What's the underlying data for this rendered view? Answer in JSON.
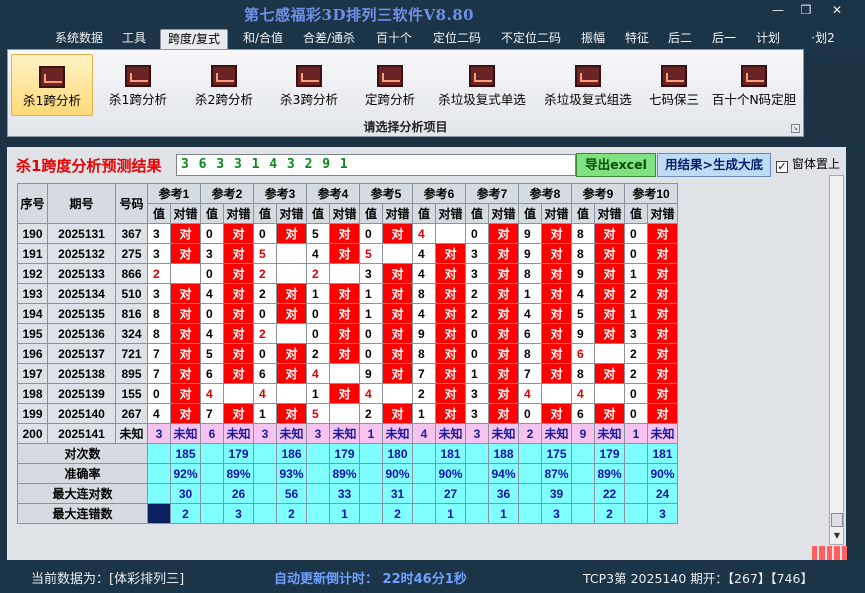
{
  "window": {
    "title": "第七感福彩3D排列三软件V8.80",
    "minimize_icon": "minimize-icon",
    "restore_icon": "restore-icon",
    "close_icon": "close-icon"
  },
  "menu": [
    {
      "label": "系统数据",
      "active": false
    },
    {
      "label": "工具",
      "active": false
    },
    {
      "label": "跨度/复式",
      "active": true
    },
    {
      "label": "和/合值",
      "active": false
    },
    {
      "label": "合差/通杀",
      "active": false
    },
    {
      "label": "百十个",
      "active": false
    },
    {
      "label": "定位二码",
      "active": false
    },
    {
      "label": "不定位二码",
      "active": false
    },
    {
      "label": "振幅",
      "active": false
    },
    {
      "label": "特征",
      "active": false
    },
    {
      "label": "后二",
      "active": false
    },
    {
      "label": "后一",
      "active": false
    },
    {
      "label": "计划",
      "active": false
    },
    {
      "label": "·划2",
      "active": false
    }
  ],
  "ribbon": {
    "buttons": [
      {
        "label": "杀1跨分析",
        "active": true,
        "icon": "chart-icon"
      },
      {
        "label": "杀1跨分析",
        "active": false,
        "icon": "chart-icon"
      },
      {
        "label": "杀2跨分析",
        "active": false,
        "icon": "chart-icon"
      },
      {
        "label": "杀3跨分析",
        "active": false,
        "icon": "chart-icon"
      },
      {
        "label": "定跨分析",
        "active": false,
        "icon": "chart-icon"
      },
      {
        "label": "杀垃圾复式单选",
        "active": false,
        "icon": "chart-icon"
      },
      {
        "label": "杀垃圾复式组选",
        "active": false,
        "icon": "chart-icon"
      },
      {
        "label": "七码保三",
        "active": false,
        "icon": "chart-icon"
      },
      {
        "label": "百十个N码定胆",
        "active": false,
        "icon": "chart-icon"
      }
    ],
    "group_label": "请选择分析项目"
  },
  "main": {
    "title": "杀1跨度分析预测结果",
    "result": "3 6 3 3 1 4 3 2 9 1",
    "export_label": "导出excel",
    "generate_label": "用结果>生成大底",
    "topmost_label": "窗体置上",
    "topmost_checked": "✓"
  },
  "table": {
    "headers": {
      "seq": "序号",
      "period": "期号",
      "number": "号码",
      "val": "值",
      "mark": "对错"
    },
    "refs": [
      "参考1",
      "参考2",
      "参考3",
      "参考4",
      "参考5",
      "参考6",
      "参考7",
      "参考8",
      "参考9",
      "参考10"
    ],
    "rows": [
      {
        "seq": "190",
        "period": "2025131",
        "number": "367",
        "cells": [
          [
            "3",
            "对"
          ],
          [
            "0",
            "对"
          ],
          [
            "0",
            "对"
          ],
          [
            "5",
            "对"
          ],
          [
            "0",
            "对"
          ],
          [
            "4",
            ""
          ],
          [
            "0",
            "对"
          ],
          [
            "9",
            "对"
          ],
          [
            "8",
            "对"
          ],
          [
            "0",
            "对"
          ]
        ]
      },
      {
        "seq": "191",
        "period": "2025132",
        "number": "275",
        "cells": [
          [
            "3",
            "对"
          ],
          [
            "3",
            "对"
          ],
          [
            "5",
            ""
          ],
          [
            "4",
            "对"
          ],
          [
            "5",
            ""
          ],
          [
            "4",
            "对"
          ],
          [
            "3",
            "对"
          ],
          [
            "9",
            "对"
          ],
          [
            "8",
            "对"
          ],
          [
            "0",
            "对"
          ]
        ]
      },
      {
        "seq": "192",
        "period": "2025133",
        "number": "866",
        "cells": [
          [
            "2",
            ""
          ],
          [
            "0",
            "对"
          ],
          [
            "2",
            ""
          ],
          [
            "2",
            ""
          ],
          [
            "3",
            "对"
          ],
          [
            "4",
            "对"
          ],
          [
            "3",
            "对"
          ],
          [
            "8",
            "对"
          ],
          [
            "9",
            "对"
          ],
          [
            "1",
            "对"
          ]
        ]
      },
      {
        "seq": "193",
        "period": "2025134",
        "number": "510",
        "cells": [
          [
            "3",
            "对"
          ],
          [
            "4",
            "对"
          ],
          [
            "2",
            "对"
          ],
          [
            "1",
            "对"
          ],
          [
            "1",
            "对"
          ],
          [
            "8",
            "对"
          ],
          [
            "2",
            "对"
          ],
          [
            "1",
            "对"
          ],
          [
            "4",
            "对"
          ],
          [
            "2",
            "对"
          ]
        ]
      },
      {
        "seq": "194",
        "period": "2025135",
        "number": "816",
        "cells": [
          [
            "8",
            "对"
          ],
          [
            "0",
            "对"
          ],
          [
            "0",
            "对"
          ],
          [
            "0",
            "对"
          ],
          [
            "1",
            "对"
          ],
          [
            "4",
            "对"
          ],
          [
            "2",
            "对"
          ],
          [
            "4",
            "对"
          ],
          [
            "5",
            "对"
          ],
          [
            "1",
            "对"
          ]
        ]
      },
      {
        "seq": "195",
        "period": "2025136",
        "number": "324",
        "cells": [
          [
            "8",
            "对"
          ],
          [
            "4",
            "对"
          ],
          [
            "2",
            ""
          ],
          [
            "0",
            "对"
          ],
          [
            "0",
            "对"
          ],
          [
            "9",
            "对"
          ],
          [
            "0",
            "对"
          ],
          [
            "6",
            "对"
          ],
          [
            "9",
            "对"
          ],
          [
            "3",
            "对"
          ]
        ]
      },
      {
        "seq": "196",
        "period": "2025137",
        "number": "721",
        "cells": [
          [
            "7",
            "对"
          ],
          [
            "5",
            "对"
          ],
          [
            "0",
            "对"
          ],
          [
            "2",
            "对"
          ],
          [
            "0",
            "对"
          ],
          [
            "8",
            "对"
          ],
          [
            "0",
            "对"
          ],
          [
            "8",
            "对"
          ],
          [
            "6",
            ""
          ],
          [
            "2",
            "对"
          ]
        ]
      },
      {
        "seq": "197",
        "period": "2025138",
        "number": "895",
        "cells": [
          [
            "7",
            "对"
          ],
          [
            "6",
            "对"
          ],
          [
            "6",
            "对"
          ],
          [
            "4",
            ""
          ],
          [
            "9",
            "对"
          ],
          [
            "7",
            "对"
          ],
          [
            "1",
            "对"
          ],
          [
            "7",
            "对"
          ],
          [
            "8",
            "对"
          ],
          [
            "2",
            "对"
          ]
        ]
      },
      {
        "seq": "198",
        "period": "2025139",
        "number": "155",
        "cells": [
          [
            "0",
            "对"
          ],
          [
            "4",
            ""
          ],
          [
            "4",
            ""
          ],
          [
            "1",
            "对"
          ],
          [
            "4",
            ""
          ],
          [
            "2",
            "对"
          ],
          [
            "3",
            "对"
          ],
          [
            "4",
            ""
          ],
          [
            "4",
            ""
          ],
          [
            "0",
            "对"
          ]
        ]
      },
      {
        "seq": "199",
        "period": "2025140",
        "number": "267",
        "cells": [
          [
            "4",
            "对"
          ],
          [
            "7",
            "对"
          ],
          [
            "1",
            "对"
          ],
          [
            "5",
            ""
          ],
          [
            "2",
            "对"
          ],
          [
            "1",
            "对"
          ],
          [
            "3",
            "对"
          ],
          [
            "0",
            "对"
          ],
          [
            "6",
            "对"
          ],
          [
            "0",
            "对"
          ]
        ]
      }
    ],
    "predict_row": {
      "seq": "200",
      "period": "2025141",
      "number": "未知",
      "cells": [
        [
          "3",
          "未知"
        ],
        [
          "6",
          "未知"
        ],
        [
          "3",
          "未知"
        ],
        [
          "3",
          "未知"
        ],
        [
          "1",
          "未知"
        ],
        [
          "4",
          "未知"
        ],
        [
          "3",
          "未知"
        ],
        [
          "2",
          "未知"
        ],
        [
          "9",
          "未知"
        ],
        [
          "1",
          "未知"
        ]
      ]
    },
    "stats": [
      {
        "label": "对次数",
        "values": [
          "185",
          "179",
          "186",
          "179",
          "180",
          "181",
          "188",
          "175",
          "179",
          "181"
        ]
      },
      {
        "label": "准确率",
        "values": [
          "92%",
          "89%",
          "93%",
          "89%",
          "90%",
          "90%",
          "94%",
          "87%",
          "89%",
          "90%"
        ]
      },
      {
        "label": "最大连对数",
        "values": [
          "30",
          "26",
          "56",
          "33",
          "31",
          "27",
          "36",
          "39",
          "22",
          "24"
        ]
      },
      {
        "label": "最大连错数",
        "values": [
          "2",
          "3",
          "2",
          "1",
          "2",
          "1",
          "1",
          "3",
          "2",
          "3"
        ]
      }
    ]
  },
  "status": {
    "data_source": "当前数据为：[体彩排列三]",
    "countdown": "自动更新倒计时：  22时46分1秒",
    "info": "TCP3第 2025140 期开：【267】【746】"
  }
}
